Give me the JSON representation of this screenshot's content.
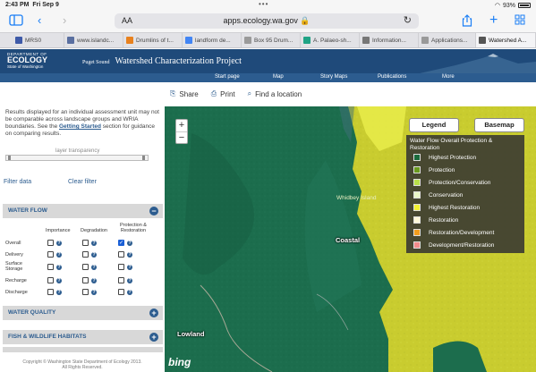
{
  "status_bar": {
    "time": "2:43 PM",
    "date": "Fri Sep 9",
    "battery": "93%"
  },
  "browser": {
    "reader_label": "AA",
    "url": "apps.ecology.wa.gov",
    "tabs": [
      {
        "label": "MRS0",
        "color": "#3e5aa8"
      },
      {
        "label": "www.islandc...",
        "color": "#5a6fa0"
      },
      {
        "label": "Drumlins of t...",
        "color": "#e8811e"
      },
      {
        "label": "landform de...",
        "color": "#4285f4"
      },
      {
        "label": "Box 95 Drum...",
        "color": "#9a9a9a"
      },
      {
        "label": "A. Palaeo-sh...",
        "color": "#1fa385"
      },
      {
        "label": "Information...",
        "color": "#777777"
      },
      {
        "label": "Applications...",
        "color": "#999999"
      },
      {
        "label": "Watershed A...",
        "color": "#555555"
      }
    ]
  },
  "site": {
    "logo_department": "DEPARTMENT OF",
    "logo_name": "ECOLOGY",
    "logo_state": "State of Washington",
    "region": "Puget Sound",
    "title": "Watershed Characterization Project",
    "nav": [
      "Start page",
      "Map",
      "Story Maps",
      "Publications",
      "More"
    ]
  },
  "actions": {
    "share": "Share",
    "print": "Print",
    "find": "Find a location"
  },
  "left_panel": {
    "notice_text": "Results displayed for an individual assessment unit may not be comparable across landscape groups and WRIA boundaries. See the",
    "notice_link": "Getting Started",
    "notice_tail": "section for guidance on comparing results.",
    "transparency_label": "layer transparency",
    "filter_data": "Filter data",
    "clear_filter": "Clear filter",
    "sections": {
      "water_flow": "WATER FLOW",
      "water_quality": "WATER QUALITY",
      "fish_wildlife": "FISH & WILDLIFE HABITATS"
    },
    "columns": [
      "Importance",
      "Degradation",
      "Protection & Restoration"
    ],
    "rows": [
      "Overall",
      "Delivery",
      "Surface Storage",
      "Recharge",
      "Discharge"
    ],
    "checked": "Overall / Protection & Restoration",
    "copyright_line1": "Copyright © Washington State Department of Ecology 2013.",
    "copyright_line2": "All Rights Reserved."
  },
  "map": {
    "zoom_in": "+",
    "zoom_out": "−",
    "legend_button": "Legend",
    "basemap_button": "Basemap",
    "legend_title": "Water Flow Overall Protection & Restoration",
    "legend_items": [
      {
        "label": "Highest Protection",
        "color": "#1a6b3c"
      },
      {
        "label": "Protection",
        "color": "#6a9a1e"
      },
      {
        "label": "Protection/Conservation",
        "color": "#b9e04a"
      },
      {
        "label": "Conservation",
        "color": "#eaf7c7"
      },
      {
        "label": "Highest Restoration",
        "color": "#f2f232"
      },
      {
        "label": "Restoration",
        "color": "#fdf8d8"
      },
      {
        "label": "Restoration/Development",
        "color": "#f29d1d"
      },
      {
        "label": "Development/Restoration",
        "color": "#f28b8b"
      }
    ],
    "labels": {
      "whidbey": "Whidbey Island",
      "coastal": "Coastal",
      "lowland": "Lowland"
    },
    "attribution": "bing"
  }
}
